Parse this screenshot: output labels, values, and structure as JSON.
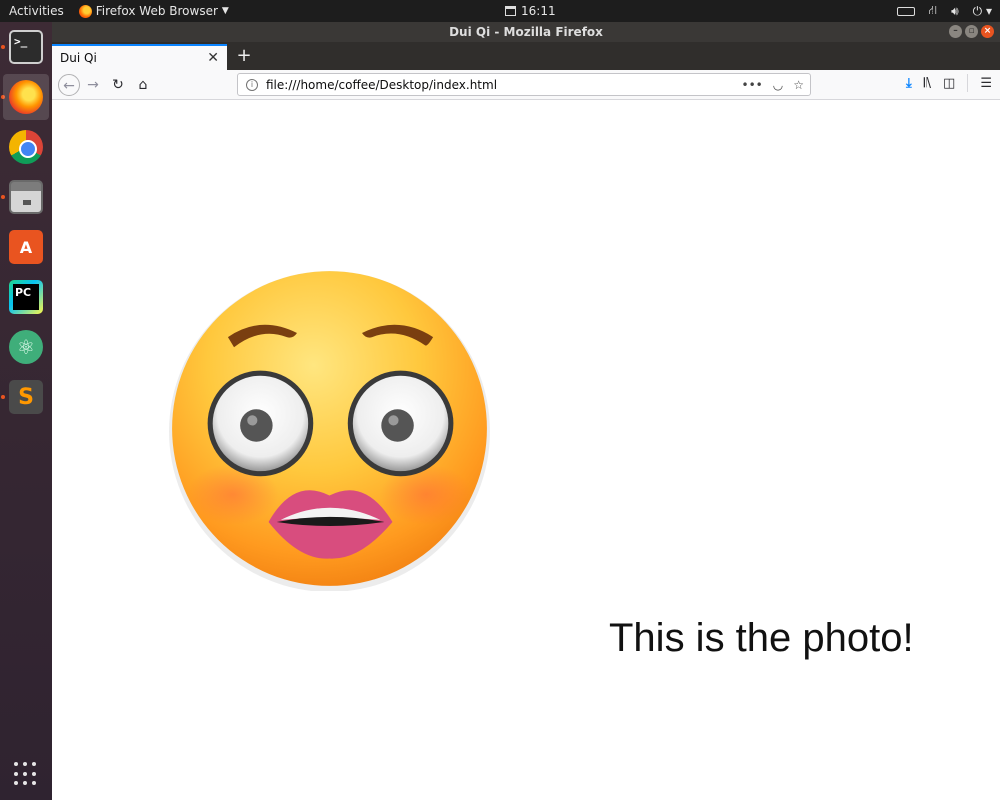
{
  "topbar": {
    "activities": "Activities",
    "app_menu": "Firefox Web Browser",
    "time": "16:11"
  },
  "dock": {
    "apps": [
      "Terminal",
      "Firefox",
      "Google Chrome",
      "Files",
      "Ubuntu Software",
      "PyCharm",
      "Atom",
      "Sublime Text"
    ]
  },
  "window": {
    "title": "Dui Qi - Mozilla Firefox"
  },
  "tab": {
    "title": "Dui Qi"
  },
  "urlbar": {
    "url": "file:///home/coffee/Desktop/index.html"
  },
  "page": {
    "photo_alt": "Flushed face emoji",
    "caption": "This is the photo!"
  },
  "colors": {
    "accent": "#0a84ff",
    "ubuntu_orange": "#e95420",
    "emoji_yellow": "#ffc83d"
  }
}
